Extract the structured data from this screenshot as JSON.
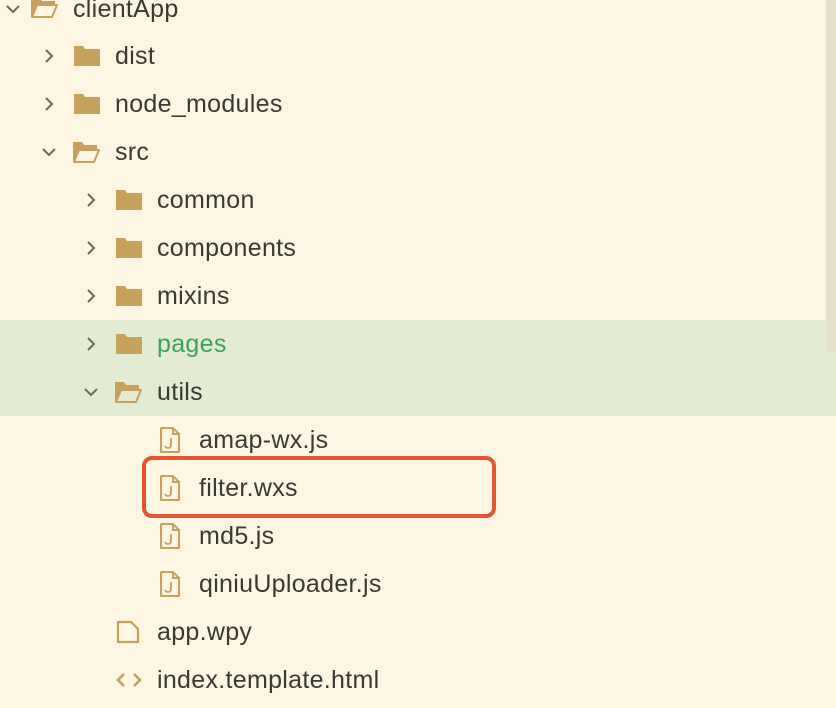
{
  "explorer": {
    "items": [
      {
        "label": "clientApp",
        "kind": "folder",
        "state": "open"
      },
      {
        "label": "dist",
        "kind": "folder",
        "state": "collapsed"
      },
      {
        "label": "node_modules",
        "kind": "folder",
        "state": "collapsed"
      },
      {
        "label": "src",
        "kind": "folder",
        "state": "open"
      },
      {
        "label": "common",
        "kind": "folder",
        "state": "collapsed"
      },
      {
        "label": "components",
        "kind": "folder",
        "state": "collapsed"
      },
      {
        "label": "mixins",
        "kind": "folder",
        "state": "collapsed"
      },
      {
        "label": "pages",
        "kind": "folder",
        "state": "collapsed",
        "highlighted": true
      },
      {
        "label": "utils",
        "kind": "folder",
        "state": "open",
        "highlighted": true
      },
      {
        "label": "amap-wx.js",
        "kind": "js-file"
      },
      {
        "label": "filter.wxs",
        "kind": "js-file",
        "annotated": true
      },
      {
        "label": "md5.js",
        "kind": "js-file"
      },
      {
        "label": "qiniuUploader.js",
        "kind": "js-file"
      },
      {
        "label": "app.wpy",
        "kind": "file"
      },
      {
        "label": "index.template.html",
        "kind": "html-file"
      }
    ]
  },
  "colors": {
    "background": "#fdf6e3",
    "selection": "#e3ecd2",
    "folder": "#c7a15d",
    "modified_text": "#3ea35a",
    "annotation_box": "#e35532"
  }
}
